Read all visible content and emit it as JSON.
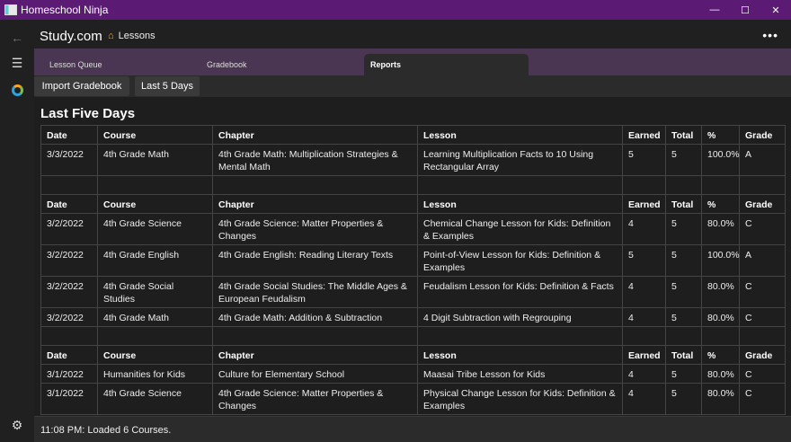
{
  "window": {
    "title": "Homeschool Ninja",
    "controls": {
      "minimize": "—",
      "maximize": "☐",
      "close": "✕"
    }
  },
  "header": {
    "brand": "Study.com",
    "breadcrumb": "Lessons",
    "more": "•••"
  },
  "tabs": [
    {
      "label": "Lesson Queue"
    },
    {
      "label": "Gradebook"
    },
    {
      "label": "Reports",
      "active": true
    }
  ],
  "toolbar": {
    "import_label": "Import Gradebook",
    "range_label": "Last 5 Days"
  },
  "report": {
    "title": "Last Five Days",
    "columns": [
      "Date",
      "Course",
      "Chapter",
      "Lesson",
      "Earned",
      "Total",
      "%",
      "Grade"
    ],
    "groups": [
      {
        "rows": [
          [
            "3/3/2022",
            "4th Grade Math",
            "4th Grade Math: Multiplication Strategies & Mental Math",
            "Learning Multiplication Facts to 10 Using Rectangular Array",
            "5",
            "5",
            "100.0%",
            "A"
          ]
        ]
      },
      {
        "rows": [
          [
            "3/2/2022",
            "4th Grade Science",
            "4th Grade Science: Matter Properties & Changes",
            "Chemical Change Lesson for Kids: Definition & Examples",
            "4",
            "5",
            "80.0%",
            "C"
          ],
          [
            "3/2/2022",
            "4th Grade English",
            "4th Grade English: Reading Literary Texts",
            "Point-of-View Lesson for Kids: Definition & Examples",
            "5",
            "5",
            "100.0%",
            "A"
          ],
          [
            "3/2/2022",
            "4th Grade Social Studies",
            "4th Grade Social Studies: The Middle Ages & European Feudalism",
            "Feudalism Lesson for Kids: Definition & Facts",
            "4",
            "5",
            "80.0%",
            "C"
          ],
          [
            "3/2/2022",
            "4th Grade Math",
            "4th Grade Math: Addition & Subtraction",
            "4 Digit Subtraction with Regrouping",
            "4",
            "5",
            "80.0%",
            "C"
          ]
        ]
      },
      {
        "rows": [
          [
            "3/1/2022",
            "Humanities for Kids",
            "Culture for Elementary School",
            "Maasai Tribe Lesson for Kids",
            "4",
            "5",
            "80.0%",
            "C"
          ],
          [
            "3/1/2022",
            "4th Grade Science",
            "4th Grade Science: Matter Properties & Changes",
            "Physical Change Lesson for Kids: Definition & Examples",
            "4",
            "5",
            "80.0%",
            "C"
          ]
        ]
      }
    ]
  },
  "status": {
    "text": "11:08 PM: Loaded 6 Courses."
  },
  "icons": {
    "back": "back-arrow-icon",
    "menu": "hamburger-menu-icon",
    "app": "app-ring-icon",
    "settings": "gear-icon",
    "home": "house-icon"
  }
}
